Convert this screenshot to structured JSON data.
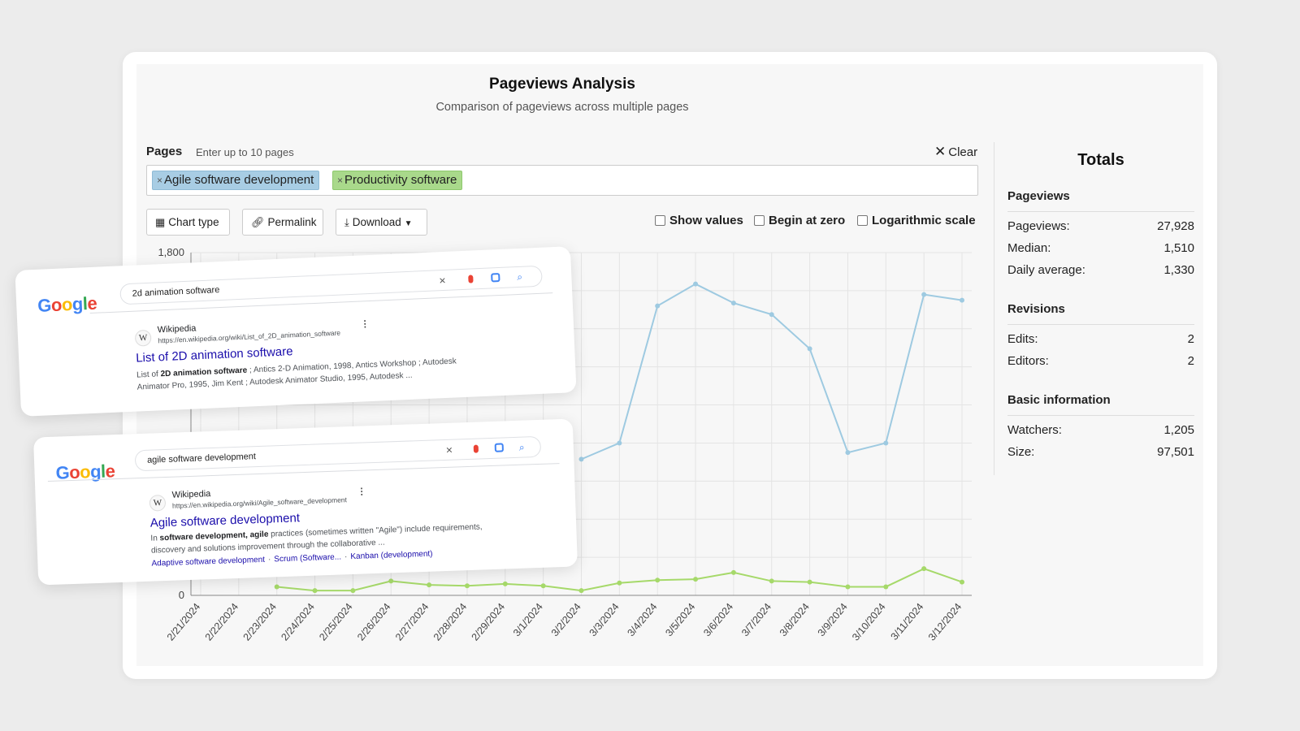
{
  "header": {
    "title": "Pageviews Analysis",
    "subtitle": "Comparison of pageviews across multiple pages"
  },
  "pages": {
    "label": "Pages",
    "hint": "Enter up to 10 pages",
    "clear_label": "Clear",
    "tags": [
      {
        "label": "Agile software development",
        "color": "#a8cde4"
      },
      {
        "label": "Productivity software",
        "color": "#a9d98b"
      }
    ]
  },
  "toolbar": {
    "chart_type": "Chart type",
    "permalink": "Permalink",
    "download": "Download",
    "show_values": "Show values",
    "begin_at_zero": "Begin at zero",
    "log_scale": "Logarithmic scale"
  },
  "totals": {
    "title": "Totals",
    "pageviews": {
      "title": "Pageviews",
      "rows": [
        {
          "label": "Pageviews:",
          "value": "27,928"
        },
        {
          "label": "Median:",
          "value": "1,510"
        },
        {
          "label": "Daily average:",
          "value": "1,330"
        }
      ]
    },
    "revisions": {
      "title": "Revisions",
      "rows": [
        {
          "label": "Edits:",
          "value": "2"
        },
        {
          "label": "Editors:",
          "value": "2"
        }
      ]
    },
    "basic": {
      "title": "Basic information",
      "rows": [
        {
          "label": "Watchers:",
          "value": "1,205"
        },
        {
          "label": "Size:",
          "value": "97,501"
        }
      ]
    }
  },
  "chart_data": {
    "type": "line",
    "x": [
      "2/21/2024",
      "2/22/2024",
      "2/23/2024",
      "2/24/2024",
      "2/25/2024",
      "2/26/2024",
      "2/27/2024",
      "2/28/2024",
      "2/29/2024",
      "3/1/2024",
      "3/2/2024",
      "3/3/2024",
      "3/4/2024",
      "3/5/2024",
      "3/6/2024",
      "3/7/2024",
      "3/8/2024",
      "3/9/2024",
      "3/10/2024",
      "3/11/2024",
      "3/12/2024"
    ],
    "y_ticks": [
      {
        "value": 1800,
        "label": "1,800"
      },
      {
        "value": 0,
        "label": "0"
      }
    ],
    "ylim": [
      0,
      1800
    ],
    "grid": true,
    "series": [
      {
        "color": "#9ecae1",
        "values": [
          null,
          null,
          null,
          null,
          null,
          null,
          null,
          null,
          null,
          null,
          715,
          800,
          1520,
          1635,
          1535,
          1475,
          1295,
          750,
          800,
          1580,
          1550
        ]
      },
      {
        "color": "#a6d96a",
        "values": [
          null,
          null,
          45,
          25,
          25,
          75,
          55,
          50,
          60,
          50,
          25,
          65,
          80,
          85,
          120,
          75,
          70,
          45,
          45,
          140,
          70
        ]
      }
    ]
  },
  "google_results": [
    {
      "logo": "Google",
      "query": "2d animation software",
      "site": "Wikipedia",
      "site_icon": "W",
      "url": "https://en.wikipedia.org/wiki/List_of_2D_animation_software",
      "title": "List of 2D animation software",
      "snippet_pre": "List of ",
      "snippet_bold": "2D animation software",
      "snippet_post": " ; Antics 2-D Animation, 1998, Antics Workshop ; Autodesk",
      "snippet_line2": "Animator Pro, 1995, Jim Kent ; Autodesk Animator Studio, 1995, Autodesk ..."
    },
    {
      "logo": "Google",
      "query": "agile software development",
      "site": "Wikipedia",
      "site_icon": "W",
      "url": "https://en.wikipedia.org/wiki/Agile_software_development",
      "title": "Agile software development",
      "snippet_pre": "In ",
      "snippet_bold": "software development, agile",
      "snippet_post": " practices (sometimes written \"Agile\") include requirements,",
      "snippet_line2": "discovery and solutions improvement through the collaborative ...",
      "links": [
        "Adaptive software development",
        "Scrum (Software...",
        "Kanban (development)"
      ]
    }
  ]
}
